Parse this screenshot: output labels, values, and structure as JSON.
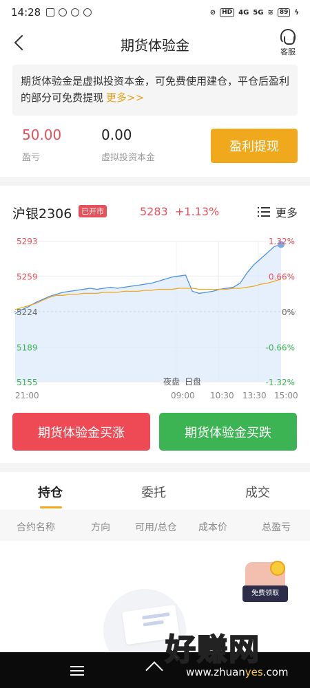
{
  "status_bar": {
    "time": "14:28",
    "network_hd": "HD",
    "network_4g": "4G",
    "network_5g": "5G",
    "battery": "89"
  },
  "header": {
    "title": "期货体验金",
    "service_label": "客服"
  },
  "notice": {
    "text": "期货体验金是虚拟投资本金，可免费使用建仓，平仓后盈利的部分可免费提现",
    "more": "更多>>"
  },
  "account": {
    "pl_value": "50.00",
    "pl_label": "盈亏",
    "principal_value": "0.00",
    "principal_label": "虚拟投资本金",
    "withdraw_label": "盈利提现"
  },
  "quote": {
    "name": "沪银2306",
    "status": "已开市",
    "price": "5283",
    "change": "+1.13%",
    "more_label": "更多"
  },
  "chart_data": {
    "type": "line",
    "y_left_labels": [
      "5293",
      "5259",
      "5224",
      "5189",
      "5155"
    ],
    "y_right_labels": [
      "1.32%",
      "0.66%",
      "0%",
      "-0.66%",
      "-1.32%"
    ],
    "x_labels": [
      "21:00",
      "09:00",
      "10:30",
      "13:30",
      "15:00"
    ],
    "session_labels": [
      "夜盘",
      "日盘"
    ],
    "ylim": [
      5155,
      5293
    ],
    "series": [
      {
        "role": "price",
        "values": [
          5222,
          5226,
          5229,
          5233,
          5236,
          5239,
          5241,
          5243,
          5244,
          5245,
          5246,
          5247,
          5246,
          5247,
          5248,
          5247,
          5248,
          5249,
          5250,
          5251,
          5252,
          5254,
          5256,
          5258,
          5259,
          5260,
          5244,
          5242,
          5243,
          5244,
          5246,
          5247,
          5248,
          5252,
          5262,
          5270,
          5276,
          5282,
          5288,
          5290
        ]
      },
      {
        "role": "average",
        "values": [
          5226,
          5228,
          5230,
          5232,
          5235,
          5238,
          5240,
          5240,
          5241,
          5241,
          5242,
          5242,
          5242,
          5243,
          5243,
          5243,
          5244,
          5244,
          5244,
          5245,
          5245,
          5246,
          5246,
          5246,
          5247,
          5247,
          5247,
          5246,
          5246,
          5246,
          5246,
          5246,
          5247,
          5247,
          5248,
          5249,
          5251,
          5252,
          5254,
          5256
        ]
      }
    ],
    "colors": {
      "price": "#4a8fe8",
      "average": "#f0a81c",
      "up": "#e5505b",
      "down": "#3cb453"
    },
    "promo_label": "免费领取"
  },
  "trade": {
    "buy_up_label": "期货体验金买涨",
    "buy_down_label": "期货体验金买跌"
  },
  "tabs": [
    {
      "label": "持仓",
      "active": true
    },
    {
      "label": "委托",
      "active": false
    },
    {
      "label": "成交",
      "active": false
    }
  ],
  "table_headers": [
    "合约名称",
    "方向",
    "可用/总仓",
    "成本价",
    "总盈亏"
  ],
  "watermark": {
    "big": "好赚网",
    "small_pre": "www.zhuan",
    "small_hl": "yes",
    "small_post": ".com"
  }
}
